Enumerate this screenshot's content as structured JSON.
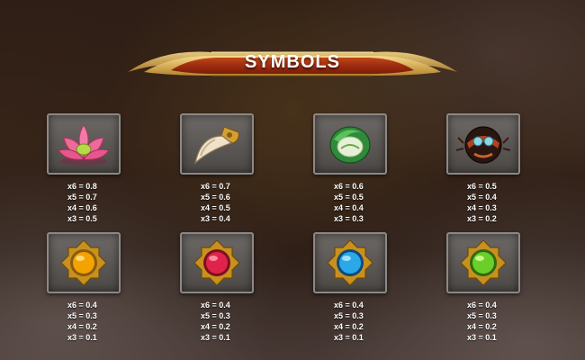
{
  "title": "SYMBOLS",
  "symbols": [
    {
      "icon": "lotus-icon",
      "pays": [
        "x6 = 0.8",
        "x5 = 0.7",
        "x4 = 0.6",
        "x3 = 0.5"
      ]
    },
    {
      "icon": "claw-icon",
      "pays": [
        "x6 = 0.7",
        "x5 = 0.6",
        "x4 = 0.5",
        "x3 = 0.4"
      ]
    },
    {
      "icon": "jade-icon",
      "pays": [
        "x6 = 0.6",
        "x5 = 0.5",
        "x4 = 0.4",
        "x3 = 0.3"
      ]
    },
    {
      "icon": "beetle-icon",
      "pays": [
        "x6 = 0.5",
        "x5 = 0.4",
        "x4 = 0.3",
        "x3 = 0.2"
      ]
    },
    {
      "icon": "orange-gem-icon",
      "gem_color": "#f2a300",
      "pays": [
        "x6 = 0.4",
        "x5 = 0.3",
        "x4 = 0.2",
        "x3 = 0.1"
      ]
    },
    {
      "icon": "red-gem-icon",
      "gem_color": "#e0234a",
      "pays": [
        "x6 = 0.4",
        "x5 = 0.3",
        "x4 = 0.2",
        "x3 = 0.1"
      ]
    },
    {
      "icon": "blue-gem-icon",
      "gem_color": "#2aa8e8",
      "pays": [
        "x6 = 0.4",
        "x5 = 0.3",
        "x4 = 0.2",
        "x3 = 0.1"
      ]
    },
    {
      "icon": "green-gem-icon",
      "gem_color": "#6bcf2a",
      "pays": [
        "x6 = 0.4",
        "x5 = 0.3",
        "x4 = 0.2",
        "x3 = 0.1"
      ]
    }
  ]
}
